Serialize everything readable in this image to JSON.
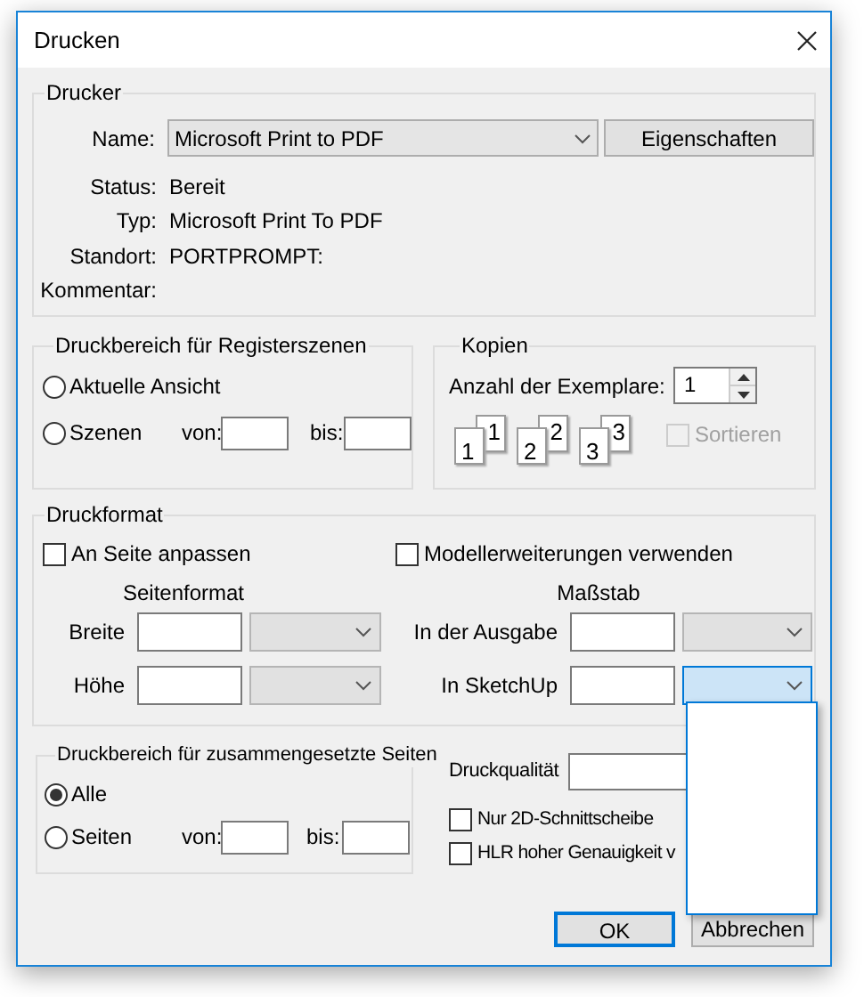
{
  "window": {
    "title": "Drucken"
  },
  "printer": {
    "legend": "Drucker",
    "name_label": "Name:",
    "name_value": "Microsoft Print to PDF",
    "properties_button": "Eigenschaften",
    "info": [
      {
        "label": "Status:",
        "value": "Bereit"
      },
      {
        "label": "Typ:",
        "value": "Microsoft Print To PDF"
      },
      {
        "label": "Standort:",
        "value": "PORTPROMPT:"
      },
      {
        "label": "Kommentar:"
      }
    ]
  },
  "scene_range": {
    "legend": "Druckbereich für Registerszenen",
    "options": [
      {
        "label": "Aktuelle Ansicht",
        "selected": false
      },
      {
        "label": "Szenen",
        "selected": false
      }
    ],
    "from_label": "von:",
    "to_label": "bis:"
  },
  "copies": {
    "legend": "Kopien",
    "count_label": "Anzahl der Exemplare:",
    "count": "1",
    "collate_pages": [
      {
        "back": "1",
        "front": "1"
      },
      {
        "back": "2",
        "front": "2"
      },
      {
        "back": "3",
        "front": "3"
      }
    ],
    "collate": {
      "label": "Sortieren",
      "checked": false,
      "disabled": true
    }
  },
  "print_format": {
    "legend": "Druckformat",
    "options": [
      {
        "label": "An Seite anpassen",
        "checked": false
      },
      {
        "label": "Modellerweiterungen verwenden",
        "checked": false
      }
    ],
    "page_size": {
      "heading": "Seitenformat",
      "rows": [
        {
          "label": "Breite"
        },
        {
          "label": "Höhe"
        }
      ]
    },
    "scale": {
      "heading": "Maßstab",
      "rows": [
        {
          "label": "In der Ausgabe",
          "expanded": false
        },
        {
          "label": "In SketchUp",
          "expanded": true
        }
      ]
    }
  },
  "tiled_range": {
    "legend": "Druckbereich für zusammengesetzte Seiten",
    "options": [
      {
        "label": "Alle",
        "selected": true
      },
      {
        "label": "Seiten",
        "selected": false
      }
    ],
    "from_label": "von:",
    "to_label": "bis:"
  },
  "quality": {
    "label": "Druckqualität"
  },
  "options": [
    {
      "label": "Nur 2D-Schnittscheibe",
      "checked": false
    },
    {
      "label": "HLR hoher Genauigkeit v",
      "checked": false
    }
  ],
  "buttons": [
    {
      "label": "OK",
      "default": true
    },
    {
      "label": "Abbrechen",
      "default": false
    }
  ]
}
